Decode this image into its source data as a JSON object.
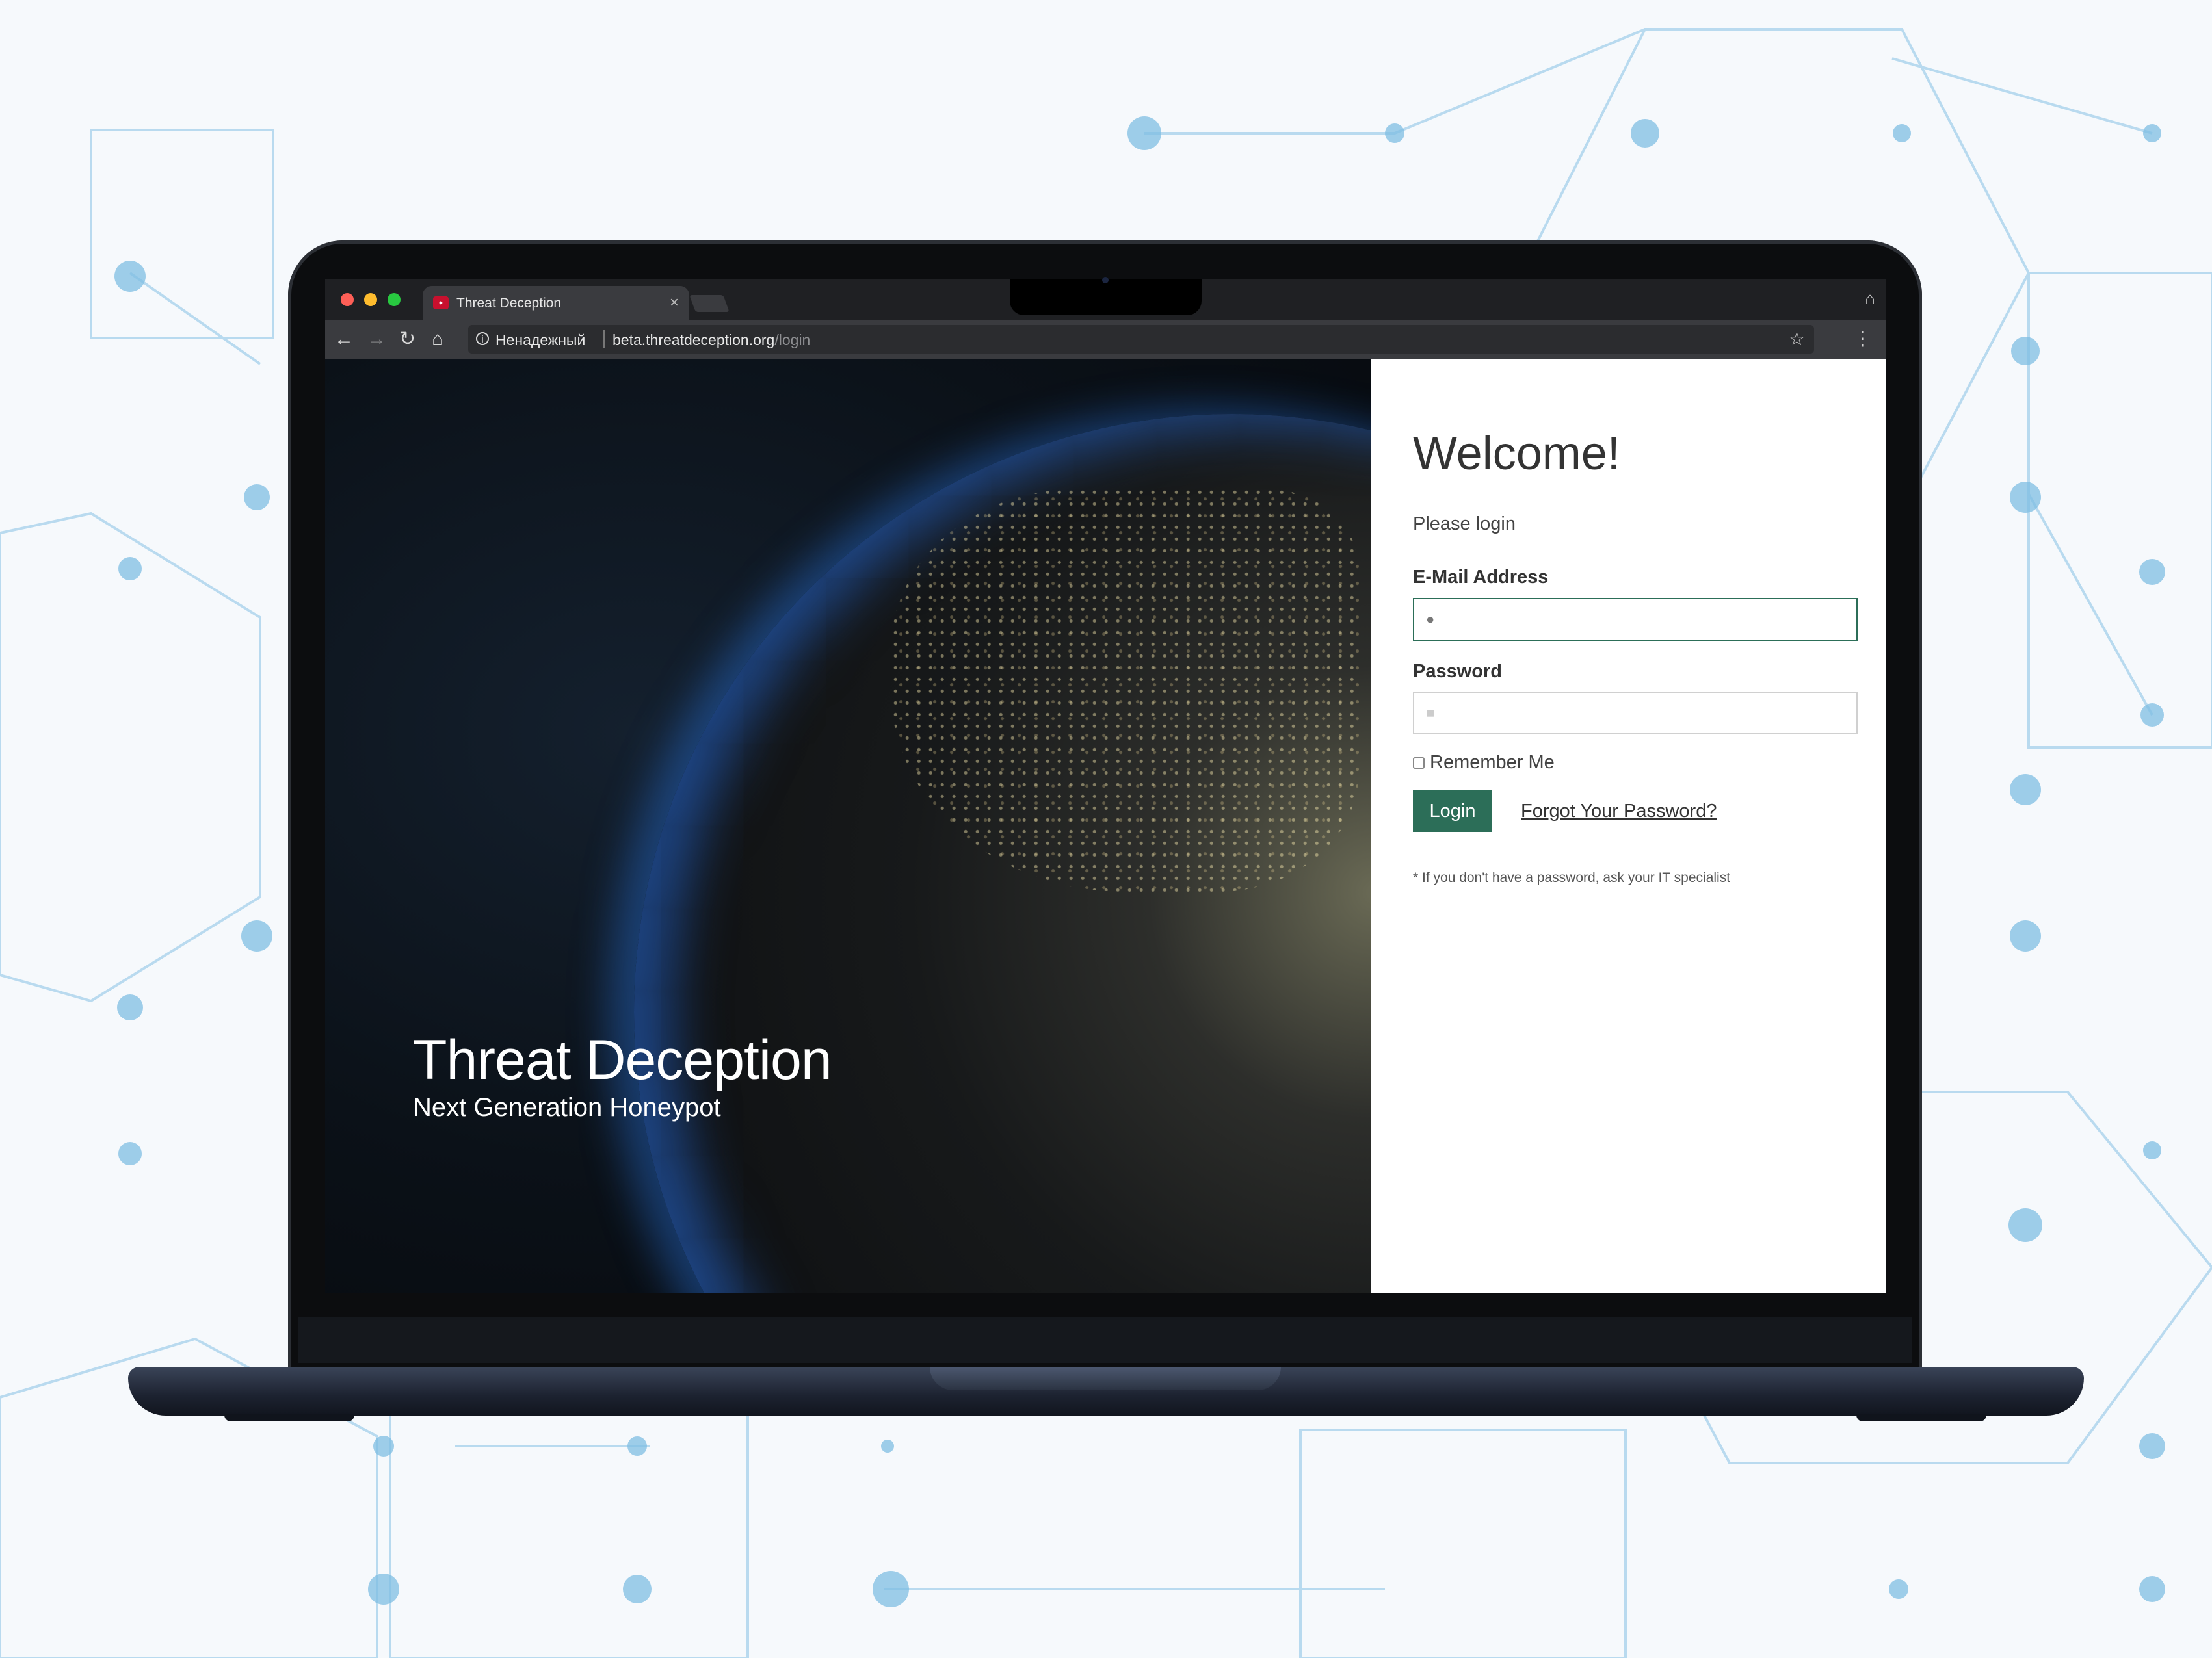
{
  "browser": {
    "tab_title": "Threat Deception",
    "security_label": "Ненадежный",
    "url_host": "beta.threatdeception.org",
    "url_path": "/login"
  },
  "hero": {
    "title": "Threat Deception",
    "subtitle": "Next Generation Honeypot"
  },
  "login": {
    "heading": "Welcome!",
    "prompt": "Please login",
    "email_label": "E-Mail Address",
    "password_label": "Password",
    "remember_label": "Remember Me",
    "login_button": "Login",
    "forgot_link": "Forgot Your Password?",
    "note": "* If you don't have a password, ask your IT specialist"
  },
  "colors": {
    "accent": "#2c6e58",
    "background": "#f6f9fc",
    "pattern": "#7fbde3"
  }
}
